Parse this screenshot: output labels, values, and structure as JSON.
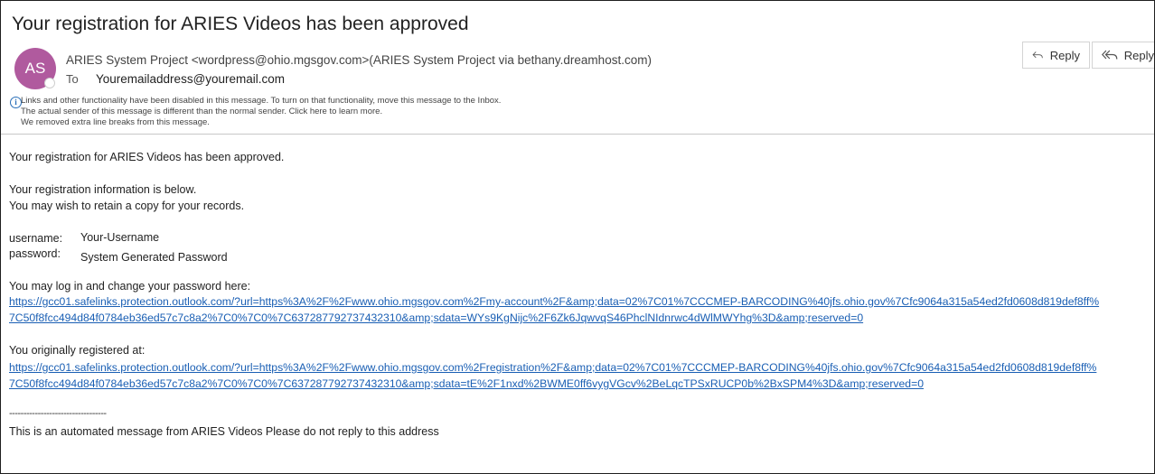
{
  "email": {
    "subject": "Your registration for ARIES Videos has been approved",
    "avatar_initials": "AS",
    "sender": "ARIES System Project <wordpress@ohio.mgsgov.com>(ARIES System Project via bethany.dreamhost.com)",
    "to_label": "To",
    "to_address": "Youremailaddress@youremail.com",
    "actions": {
      "reply_label": "Reply",
      "reply_all_label": "Reply"
    },
    "info_messages": [
      "Links and other functionality have been disabled in this message. To turn on that functionality, move this message to the Inbox.",
      "The actual sender of this message is different than the normal sender. Click here to learn more.",
      "We removed extra line breaks from this message."
    ],
    "body": {
      "line1": "Your registration for ARIES Videos has been approved.",
      "line2": "Your registration information is below.",
      "line3": "You may wish to retain a copy for your records.",
      "username_label": "username:",
      "username_value": "Your-Username",
      "password_label": "password:",
      "password_value": "System Generated Password",
      "change_password_text": "You may log in and change your password here:",
      "change_password_link_1": "https://gcc01.safelinks.protection.outlook.com/?url=https%3A%2F%2Fwww.ohio.mgsgov.com%2Fmy-account%2F&amp;data=02%7C01%7CCCMEP-BARCODING%40jfs.ohio.gov%7Cfc9064a315a54ed2fd0608d819def8ff%",
      "change_password_link_2": "7C50f8fcc494d84f0784eb36ed57c7c8a2%7C0%7C0%7C637287792737432310&amp;sdata=WYs9KgNijc%2F6Zk6JqwvqS46PhclNIdnrwc4dWlMWYhg%3D&amp;reserved=0",
      "registered_text": "You originally registered at:",
      "registered_link_1": "https://gcc01.safelinks.protection.outlook.com/?url=https%3A%2F%2Fwww.ohio.mgsgov.com%2Fregistration%2F&amp;data=02%7C01%7CCCMEP-BARCODING%40jfs.ohio.gov%7Cfc9064a315a54ed2fd0608d819def8ff%",
      "registered_link_2": "7C50f8fcc494d84f0784eb36ed57c7c8a2%7C0%7C0%7C637287792737432310&amp;sdata=tE%2F1nxd%2BWME0ff6vygVGcv%2BeLqcTPSxRUCP0b%2BxSPM4%3D&amp;reserved=0",
      "dashes": "----------------------------------",
      "footer": "This is an automated message from ARIES Videos Please do not reply to this address"
    }
  }
}
